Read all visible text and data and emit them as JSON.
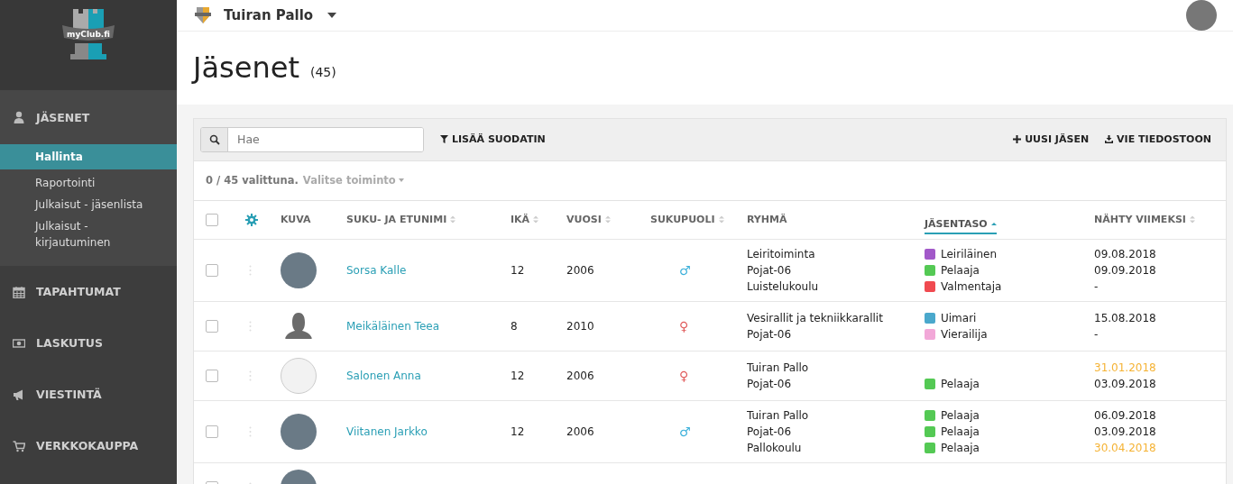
{
  "sidebar": {
    "logo": {
      "text": "myClub.fi"
    },
    "sections": [
      {
        "kind": "user",
        "label": "JÄSENET",
        "expanded": true,
        "items": [
          {
            "label": "Hallinta",
            "selected": true
          },
          {
            "label": "Raportointi",
            "selected": false
          },
          {
            "label": "Julkaisut - jäsenlista",
            "selected": false
          },
          {
            "label": "Julkaisut - kirjautuminen",
            "selected": false
          }
        ]
      },
      {
        "kind": "calendar",
        "label": "TAPAHTUMAT",
        "expanded": false
      },
      {
        "kind": "money",
        "label": "LASKUTUS",
        "expanded": false
      },
      {
        "kind": "megaphone",
        "label": "VIESTINTÄ",
        "expanded": false
      },
      {
        "kind": "cart",
        "label": "VERKKOKAUPPA",
        "expanded": false
      }
    ]
  },
  "topbar": {
    "club": "Tuiran Pallo"
  },
  "page": {
    "title": "Jäsenet",
    "count": "(45)"
  },
  "toolbar": {
    "search": {
      "placeholder": "Hae"
    },
    "filter": "LISÄÄ SUODATIN",
    "new_member": "UUSI JÄSEN",
    "export": "VIE TIEDOSTOON"
  },
  "selection": {
    "status": "0 / 45 valittuna.",
    "action": "Valitse toiminto"
  },
  "table": {
    "all_checked": false,
    "columns": [
      {
        "label": "KUVA",
        "sortable": false,
        "selected": false
      },
      {
        "label": "SUKU- JA ETUNIMI",
        "sortable": true,
        "selected": false
      },
      {
        "label": "IKÄ",
        "sortable": true,
        "selected": false
      },
      {
        "label": "VUOSI",
        "sortable": true,
        "selected": false
      },
      {
        "label": "SUKUPUOLI",
        "sortable": true,
        "selected": false
      },
      {
        "label": "RYHMÄ",
        "sortable": false,
        "selected": false
      },
      {
        "label": "JÄSENTASO",
        "sortable": true,
        "selected": true
      },
      {
        "label": "NÄHTY VIIMEKSI",
        "sortable": true,
        "selected": false
      }
    ],
    "rows": [
      {
        "checked": false,
        "avatar": {
          "kind": "photo"
        },
        "name": "Sorsa Kalle",
        "age": "12",
        "year": "2006",
        "gender": {
          "kind": "male",
          "symbol": "♂"
        },
        "memberships": [
          {
            "group": "Leiritoiminta",
            "level": "Leiriläinen",
            "color": "#a259c9",
            "seen": "09.08.2018",
            "stale": false
          },
          {
            "group": "Pojat-06",
            "level": "Pelaaja",
            "color": "#54c954",
            "seen": "09.09.2018",
            "stale": false
          },
          {
            "group": "Luistelukoulu",
            "level": "Valmentaja",
            "color": "#f04a50",
            "seen": "-",
            "stale": false
          }
        ]
      },
      {
        "checked": false,
        "avatar": {
          "kind": "silhouette"
        },
        "name": "Meikäläinen Teea",
        "age": "8",
        "year": "2010",
        "gender": {
          "kind": "female",
          "symbol": "♀"
        },
        "memberships": [
          {
            "group": "Vesirallit ja tekniikkarallit",
            "level": "Uimari",
            "color": "#4aa8cc",
            "seen": "15.08.2018",
            "stale": false
          },
          {
            "group": "Pojat-06",
            "level": "Vierailija",
            "color": "#f2a8d8",
            "seen": "-",
            "stale": false
          }
        ]
      },
      {
        "checked": false,
        "avatar": {
          "kind": "drawing"
        },
        "name": "Salonen Anna",
        "age": "12",
        "year": "2006",
        "gender": {
          "kind": "female",
          "symbol": "♀"
        },
        "memberships": [
          {
            "group": "Tuiran Pallo",
            "seen": "31.01.2018",
            "stale": true
          },
          {
            "group": "Pojat-06",
            "level": "Pelaaja",
            "color": "#54c954",
            "seen": "03.09.2018",
            "stale": false
          }
        ]
      },
      {
        "checked": false,
        "avatar": {
          "kind": "photo"
        },
        "name": "Viitanen Jarkko",
        "age": "12",
        "year": "2006",
        "gender": {
          "kind": "male",
          "symbol": "♂"
        },
        "memberships": [
          {
            "group": "Tuiran Pallo",
            "level": "Pelaaja",
            "color": "#54c954",
            "seen": "06.09.2018",
            "stale": false
          },
          {
            "group": "Pojat-06",
            "level": "Pelaaja",
            "color": "#54c954",
            "seen": "03.09.2018",
            "stale": false
          },
          {
            "group": "Pallokoulu",
            "level": "Pelaaja",
            "color": "#54c954",
            "seen": "30.04.2018",
            "stale": true
          }
        ]
      },
      {
        "checked": false,
        "avatar": {
          "kind": "photo"
        }
      }
    ]
  }
}
